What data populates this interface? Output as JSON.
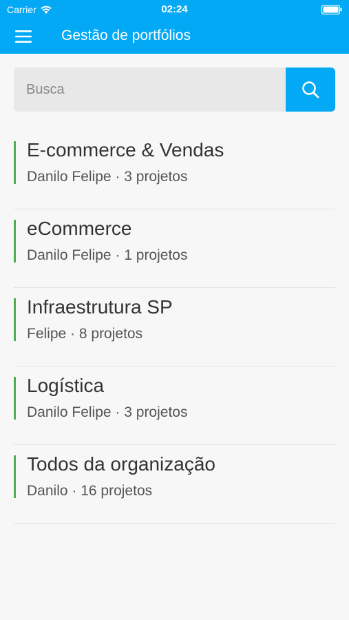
{
  "status_bar": {
    "carrier": "Carrier",
    "time": "02:24",
    "wifi_icon": "wifi-icon",
    "battery_icon": "battery-icon"
  },
  "header": {
    "title": "Gestão de portfólios",
    "menu_icon": "hamburger-menu-icon",
    "background": "#03a9f4"
  },
  "search": {
    "placeholder": "Busca",
    "value": "",
    "button_icon": "search-icon"
  },
  "portfolios": [
    {
      "name": "E-commerce & Vendas",
      "owner": "Danilo Felipe",
      "separator": " · ",
      "projects": "3 projetos"
    },
    {
      "name": "eCommerce",
      "owner": "Danilo Felipe",
      "separator": " · ",
      "projects": "1 projetos"
    },
    {
      "name": "Infraestrutura SP",
      "owner": "Felipe",
      "separator": " · ",
      "projects": "8 projetos"
    },
    {
      "name": "Logística",
      "owner": "Danilo Felipe",
      "separator": " · ",
      "projects": "3 projetos"
    },
    {
      "name": "Todos da organização",
      "owner": "Danilo",
      "separator": " · ",
      "projects": "16 projetos"
    }
  ],
  "colors": {
    "accent": "#03a9f4",
    "status_bar_green": "#4caf50",
    "background": "#f7f7f7"
  }
}
